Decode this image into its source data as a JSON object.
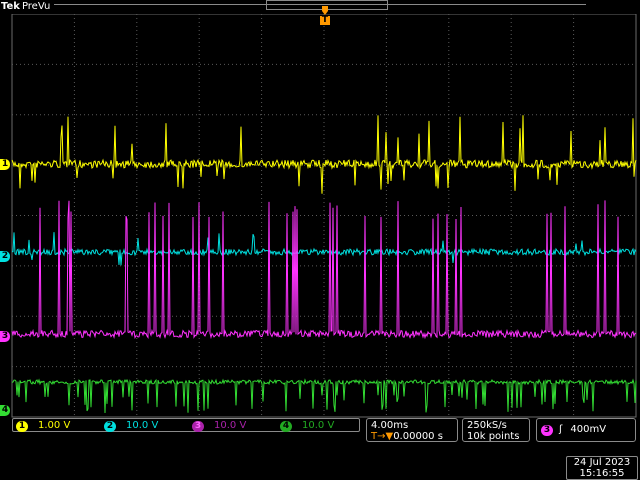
{
  "header": {
    "brand": "Tek",
    "mode": "PreVu"
  },
  "trigger_marker": "T",
  "channels": [
    {
      "id": "1",
      "scale": "1.00 V",
      "color": "#ffff00"
    },
    {
      "id": "2",
      "scale": "10.0 V",
      "color": "#00e0e0"
    },
    {
      "id": "3",
      "scale": "10.0 V",
      "color": "#ff33ff"
    },
    {
      "id": "4",
      "scale": "10.0 V",
      "color": "#33dd33"
    }
  ],
  "timebase": {
    "scale": "4.00ms",
    "position": "0.00000 s",
    "position_prefix": "T→▼"
  },
  "acquisition": {
    "rate": "250kS/s",
    "points": "10k points"
  },
  "trigger": {
    "source": "3",
    "slope_icon": "rising-edge-icon",
    "slope_glyph": "ʃ",
    "level": "400mV"
  },
  "datetime": {
    "date": "24 Jul  2023",
    "time": "15:16:55"
  }
}
